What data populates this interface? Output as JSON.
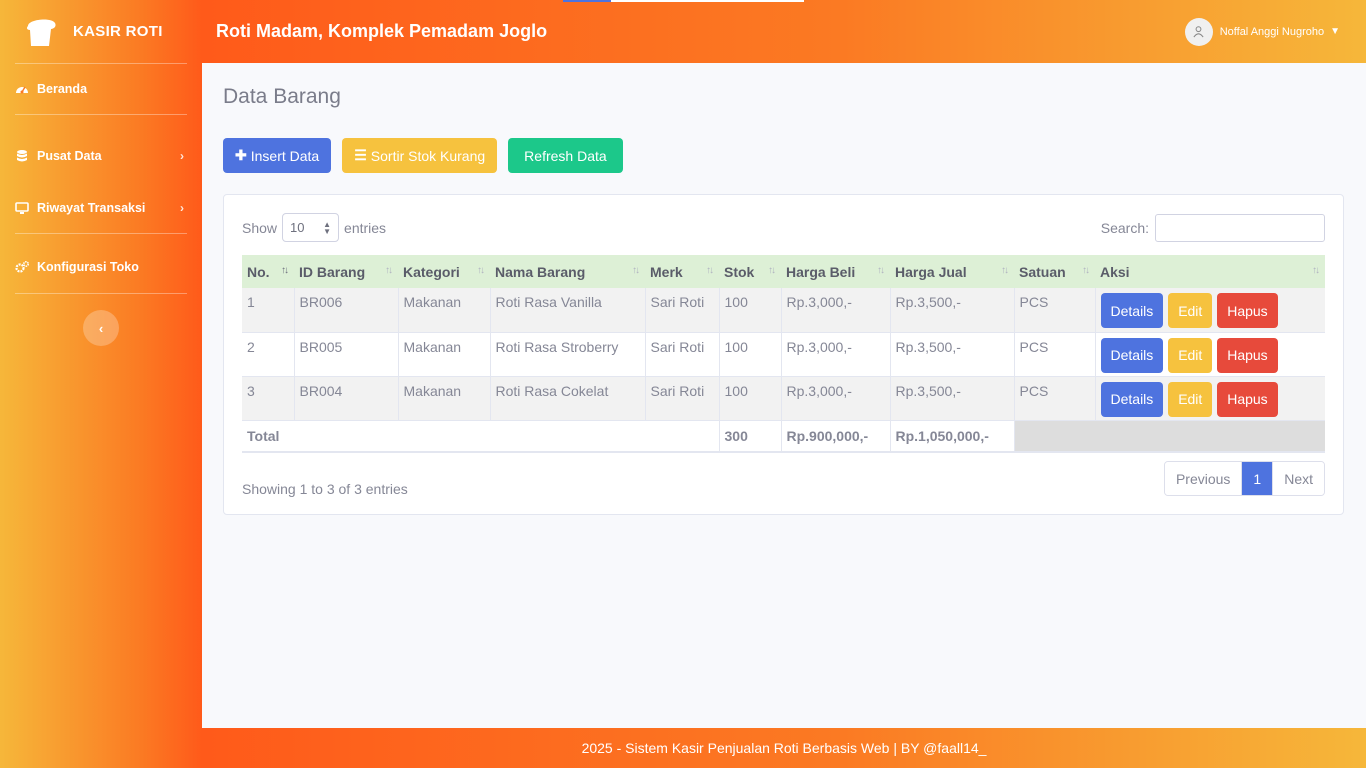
{
  "sidebar": {
    "brand": "KASIR ROTI",
    "items": [
      {
        "label": "Beranda",
        "icon": "dashboard-icon"
      },
      {
        "label": "Pusat Data",
        "icon": "database-icon",
        "chevron": "›"
      },
      {
        "label": "Riwayat Transaksi",
        "icon": "desktop-icon",
        "chevron": "›"
      },
      {
        "label": "Konfigurasi Toko",
        "icon": "cogs-icon"
      }
    ],
    "toggle": "‹"
  },
  "topbar": {
    "title": "Roti Madam, Komplek Pemadam Joglo",
    "user": "Noffal Anggi Nugroho"
  },
  "page": {
    "title": "Data Barang",
    "actions": {
      "insert": "Insert Data",
      "sort": "Sortir Stok Kurang",
      "refresh": "Refresh Data"
    }
  },
  "datatable": {
    "show": "Show",
    "entries_value": "10",
    "entries": "entries",
    "search_label": "Search:",
    "columns": [
      "No.",
      "ID Barang",
      "Kategori",
      "Nama Barang",
      "Merk",
      "Stok",
      "Harga Beli",
      "Harga Jual",
      "Satuan",
      "Aksi"
    ],
    "rows": [
      {
        "no": "1",
        "id": "BR006",
        "kategori": "Makanan",
        "nama": "Roti Rasa Vanilla",
        "merk": "Sari Roti",
        "stok": "100",
        "beli": "Rp.3,000,-",
        "jual": "Rp.3,500,-",
        "satuan": "PCS"
      },
      {
        "no": "2",
        "id": "BR005",
        "kategori": "Makanan",
        "nama": "Roti Rasa Stroberry",
        "merk": "Sari Roti",
        "stok": "100",
        "beli": "Rp.3,000,-",
        "jual": "Rp.3,500,-",
        "satuan": "PCS"
      },
      {
        "no": "3",
        "id": "BR004",
        "kategori": "Makanan",
        "nama": "Roti Rasa Cokelat",
        "merk": "Sari Roti",
        "stok": "100",
        "beli": "Rp.3,000,-",
        "jual": "Rp.3,500,-",
        "satuan": "PCS"
      }
    ],
    "row_actions": {
      "details": "Details",
      "edit": "Edit",
      "hapus": "Hapus"
    },
    "total": {
      "label": "Total",
      "stok": "300",
      "beli": "Rp.900,000,-",
      "jual": "Rp.1,050,000,-"
    },
    "info": "Showing 1 to 3 of 3 entries",
    "pager": {
      "previous": "Previous",
      "page": "1",
      "next": "Next"
    }
  },
  "footer": "2025 - Sistem Kasir Penjualan Roti Berbasis Web | BY @faall14_",
  "colors": {
    "primary": "#4e73df",
    "warning": "#f6c23e",
    "success": "#1cc88a",
    "danger": "#e74a3b",
    "orange": "#fb7a23"
  }
}
